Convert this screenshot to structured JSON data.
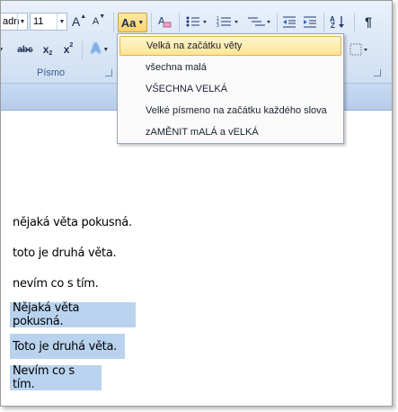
{
  "ribbon": {
    "font_name": "adn",
    "font_size": "11",
    "grow_font": "A",
    "shrink_font": "A",
    "change_case": "Aa",
    "clear_format": "A",
    "strikethrough": "abc",
    "subscript": "x",
    "superscript": "x",
    "text_effect": "A",
    "sort": "A",
    "show_marks": "¶",
    "group_font_label": "Písmo"
  },
  "menu": {
    "items": [
      {
        "label": "Velká na začátku věty"
      },
      {
        "label": "všechna malá"
      },
      {
        "label": "VŠECHNA VELKÁ"
      },
      {
        "label": "Velké písmeno na začátku každého slova"
      },
      {
        "label": "zAMĚNIT mALÁ a vELKÁ"
      }
    ]
  },
  "document": {
    "lines": [
      "nějaká věta pokusná.",
      "toto je druhá věta.",
      "nevím co s tím.",
      "Nějaká věta pokusná.",
      "Toto je druhá věta.",
      "Nevím co s tím."
    ]
  },
  "colors": {
    "selection": "#b9d3ef",
    "ribbon": "#dbe7f6",
    "highlight": "#fde592"
  }
}
